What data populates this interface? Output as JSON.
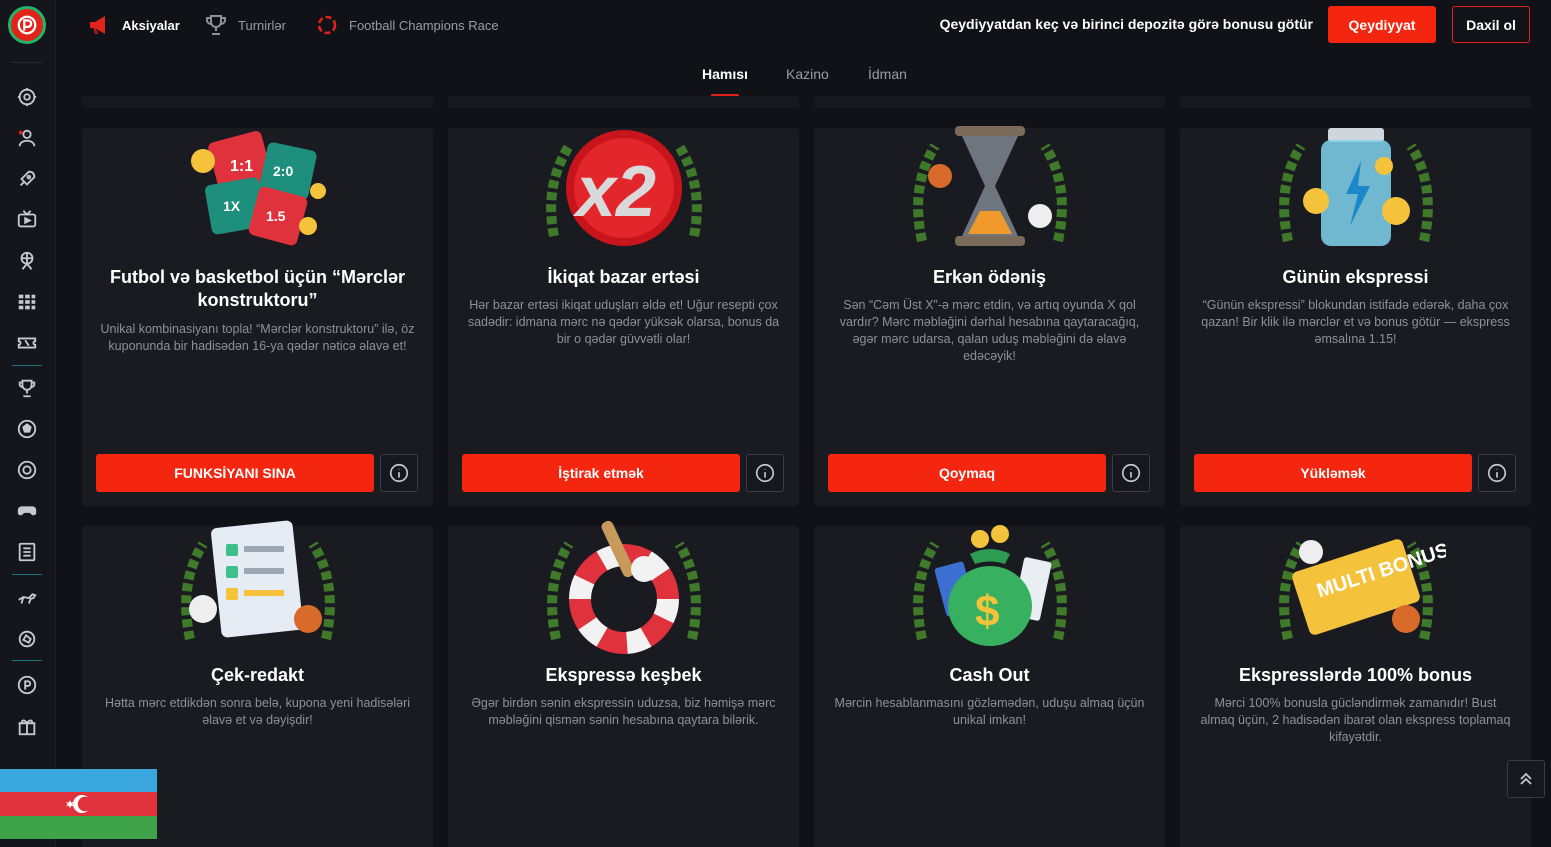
{
  "header": {
    "nav": [
      {
        "label": "Aksiyalar",
        "icon": "megaphone-icon"
      },
      {
        "label": "Turnirlər",
        "icon": "trophy-icon"
      },
      {
        "label": "Football Champions Race",
        "icon": "race-icon"
      }
    ],
    "promo_text": "Qeydiyyatdan keç və birinci depozitə görə bonusu götür",
    "register_label": "Qeydiyyat",
    "login_label": "Daxil ol"
  },
  "tabs": [
    {
      "label": "Hamısı",
      "active": true
    },
    {
      "label": "Kazino",
      "active": false
    },
    {
      "label": "İdman",
      "active": false
    }
  ],
  "sidebar": {
    "icons": [
      "settings-icon",
      "user-support-icon",
      "rocket-icon",
      "live-tv-icon",
      "basketball-player-icon",
      "calendar-grid-icon",
      "ticket-icon",
      "trophy-cup-icon",
      "football-icon",
      "target-icon",
      "gamepad-icon",
      "news-icon",
      "horse-racing-icon",
      "esports-icon",
      "brand-p-icon",
      "gift-icon"
    ]
  },
  "cards": [
    {
      "title": "Futbol və basketbol üçün “Mərclər konstruktoru”",
      "description": "Unikal kombinasiyanı topla! “Mərclər konstruktoru” ilə, öz kuponunda bir hadisədən 16-ya qədər nəticə əlavə et!",
      "button": "FUNKSİYANI SINA",
      "image": "puzzle-dice-icon"
    },
    {
      "title": "İkiqat bazar ertəsi",
      "description": "Hər bazar ertəsi ikiqat uduşları əldə et! Uğur resepti çox sadədir: idmana mərc nə qədər yüksək olarsa, bonus da bir o qədər güvvətli olar!",
      "button": "İştirak etmək",
      "image": "x2-badge-icon"
    },
    {
      "title": "Erkən ödəniş",
      "description": "Sən “Cəm Üst X”-ə mərc etdin, və artıq oyunda X qol vardır? Mərc məbləğini dərhal hesabına qaytaracağıq, əgər mərc udarsa, qalan uduş məbləğini də əlavə edəcəyik!",
      "button": "Qoymaq",
      "image": "hourglass-icon"
    },
    {
      "title": "Günün ekspressi",
      "description": "“Günün ekspressi” blokundan istifadə edərək, daha çox qazan! Bir klik ilə mərclər et və bonus götür — ekspress əmsalına 1.15!",
      "button": "Yükləmək",
      "image": "battery-coins-icon"
    },
    {
      "title": "Çek-redakt",
      "description": "Hətta mərc etdikdən sonra belə, kupona yeni hadisələri əlavə et və dəyişdir!",
      "image": "checklist-icon"
    },
    {
      "title": "Ekspressə keşbek",
      "description": "Əgər birdən sənin ekspressin uduzsa, biz həmişə mərc məbləğini qismən sənin hesabına qaytara bilərik.",
      "image": "lifebuoy-icon"
    },
    {
      "title": "Cash Out",
      "description": "Mərcin hesablanmasını gözləmədən, uduşu almaq üçün unikal imkan!",
      "image": "money-bag-icon"
    },
    {
      "title": "Ekspresslərdə 100% bonus",
      "description": "Mərci 100% bonusla gücləndirmək zamanıdır! Bust almaq üçün, 2 hadisədən ibarət olan ekspress toplamaq kifayətdir.",
      "image": "multi-bonus-icon",
      "badge": "MULTI BONUS"
    }
  ],
  "colors": {
    "accent": "#f4260f",
    "background": "#111217",
    "card": "#1a1b21",
    "muted_text": "#8e9099"
  }
}
